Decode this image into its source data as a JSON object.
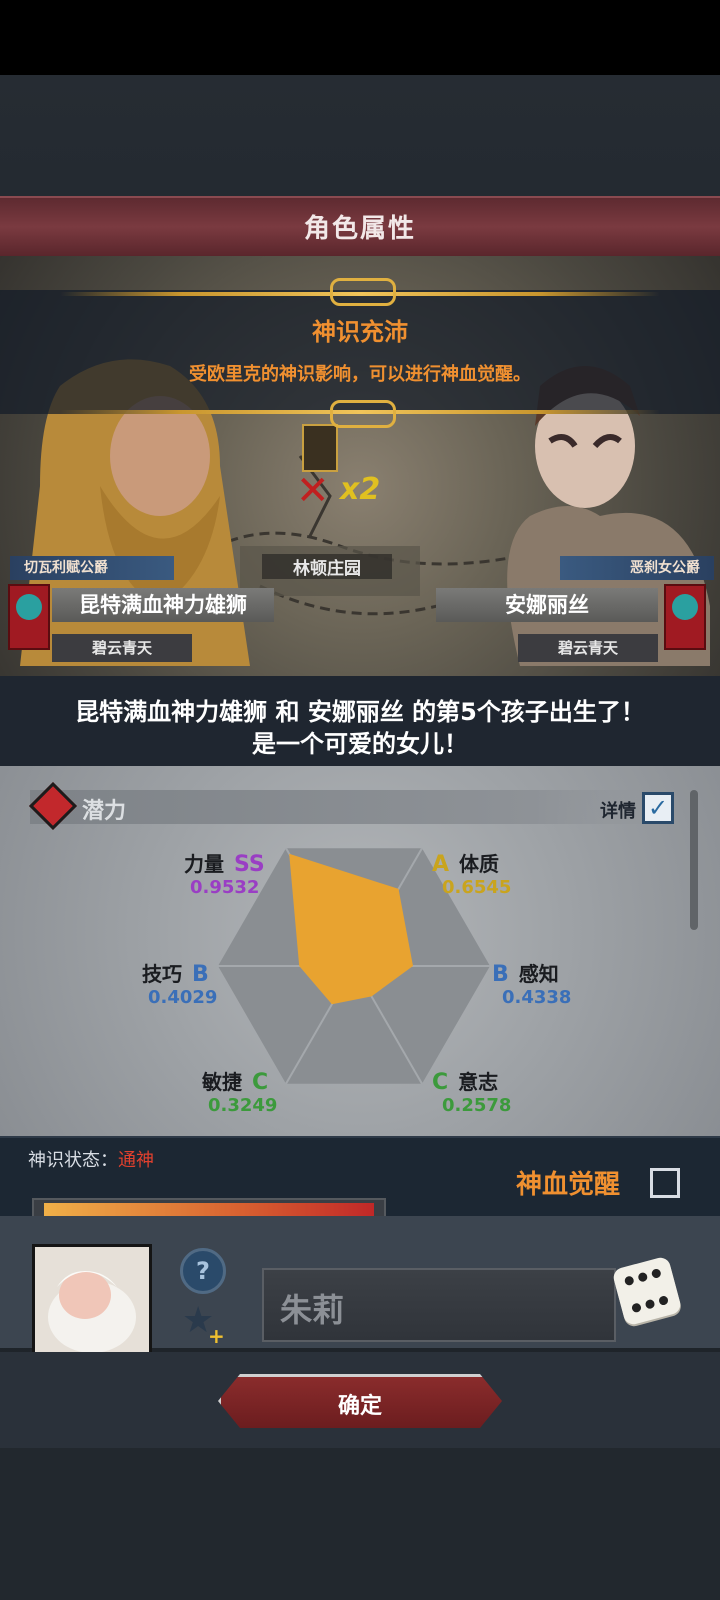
{
  "header": {
    "title": "角色属性"
  },
  "event_banner": {
    "title": "神识充沛",
    "subtitle": "受欧里克的神识影响，可以进行神血觉醒。"
  },
  "map": {
    "location_label": "林顿庄园",
    "multiplier_label": "x2"
  },
  "father": {
    "title": "切瓦利赋公爵",
    "name": "昆特满血神力雄狮",
    "faction": "碧云青天"
  },
  "mother": {
    "title": "恶刹女公爵",
    "name": "安娜丽丝",
    "faction": "碧云青天"
  },
  "announcement": {
    "line1": "昆特满血神力雄狮 和 安娜丽丝 的第5个孩子出生了！",
    "line2": "是一个可爱的女儿！"
  },
  "potential": {
    "title": "潜力",
    "details_label": "详情",
    "details_checked": true,
    "stats": [
      {
        "name": "力量",
        "grade": "SS",
        "value": "0.9532",
        "color": "#9a3ec4"
      },
      {
        "name": "体质",
        "grade": "A",
        "value": "0.6545",
        "color": "#c9a41e"
      },
      {
        "name": "感知",
        "grade": "B",
        "value": "0.4338",
        "color": "#3a6fb8"
      },
      {
        "name": "意志",
        "grade": "C",
        "value": "0.2578",
        "color": "#3c9a3c"
      },
      {
        "name": "敏捷",
        "grade": "C",
        "value": "0.3249",
        "color": "#3c9a3c"
      },
      {
        "name": "技巧",
        "grade": "B",
        "value": "0.4029",
        "color": "#3a6fb8"
      }
    ],
    "radar_color": "#e8a330"
  },
  "status": {
    "label": "神识状态：",
    "value": "通神",
    "progress": 1.0,
    "awaken_label": "神血觉醒",
    "awaken_checked": false
  },
  "child": {
    "name": "朱莉",
    "help_icon": "question-icon",
    "favorite_icon": "star-plus-icon",
    "randomize_icon": "dice-icon"
  },
  "footer": {
    "confirm_label": "确定"
  }
}
